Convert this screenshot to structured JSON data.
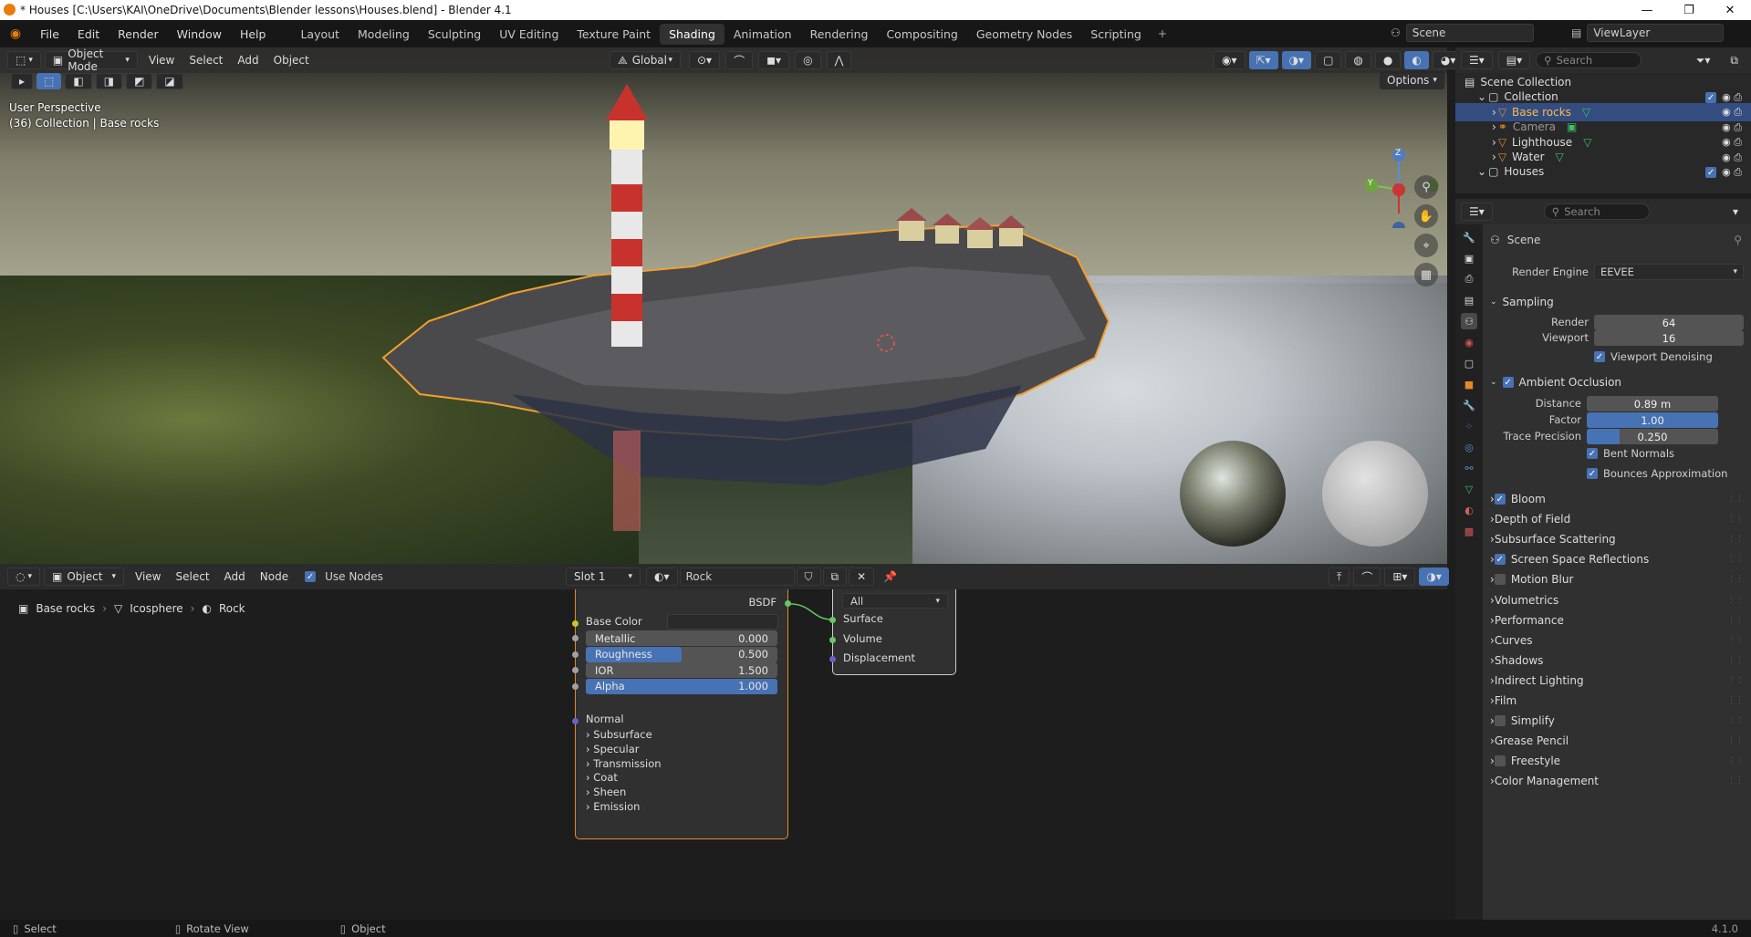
{
  "window": {
    "title": "* Houses [C:\\Users\\KAI\\OneDrive\\Documents\\Blender lessons\\Houses.blend] - Blender 4.1",
    "minimize": "—",
    "maximize": "❐",
    "close": "✕"
  },
  "menu": [
    "File",
    "Edit",
    "Render",
    "Window",
    "Help"
  ],
  "workspaces": [
    "Layout",
    "Modeling",
    "Sculpting",
    "UV Editing",
    "Texture Paint",
    "Shading",
    "Animation",
    "Rendering",
    "Compositing",
    "Geometry Nodes",
    "Scripting"
  ],
  "active_workspace": "Shading",
  "scene_field": "Scene",
  "viewlayer_field": "ViewLayer",
  "viewport": {
    "mode": "Object Mode",
    "menu": [
      "View",
      "Select",
      "Add",
      "Object"
    ],
    "transform_orientation": "Global",
    "options_label": "Options",
    "overlay_line1": "User Perspective",
    "overlay_line2": "(36) Collection | Base rocks",
    "gizmo_axes": {
      "z": "Z",
      "y": "Y"
    }
  },
  "node_editor": {
    "type": "Object",
    "menu": [
      "View",
      "Select",
      "Add",
      "Node"
    ],
    "use_nodes_label": "Use Nodes",
    "slot": "Slot 1",
    "material": "Rock",
    "breadcrumb": [
      "Base rocks",
      "Icosphere",
      "Rock"
    ],
    "bsdf": {
      "header": "BSDF",
      "base_color_label": "Base Color",
      "fields": [
        {
          "label": "Metallic",
          "value": "0.000",
          "fill": 0
        },
        {
          "label": "Roughness",
          "value": "0.500",
          "fill": 0.5
        },
        {
          "label": "IOR",
          "value": "1.500",
          "fill": 0
        },
        {
          "label": "Alpha",
          "value": "1.000",
          "fill": 1
        }
      ],
      "normal_label": "Normal",
      "subpanels": [
        "Subsurface",
        "Specular",
        "Transmission",
        "Coat",
        "Sheen",
        "Emission"
      ]
    },
    "material_output": {
      "target": "All",
      "inputs": [
        "Surface",
        "Volume",
        "Displacement"
      ]
    }
  },
  "outliner": {
    "search_placeholder": "Search",
    "rows": [
      {
        "label": "Scene Collection",
        "indent": 0,
        "kind": "scene"
      },
      {
        "label": "Collection",
        "indent": 1,
        "kind": "collection"
      },
      {
        "label": "Base rocks",
        "indent": 2,
        "kind": "mesh",
        "selected": true
      },
      {
        "label": "Camera",
        "indent": 2,
        "kind": "camera"
      },
      {
        "label": "Lighthouse",
        "indent": 2,
        "kind": "mesh"
      },
      {
        "label": "Water",
        "indent": 2,
        "kind": "mesh"
      },
      {
        "label": "Houses",
        "indent": 1,
        "kind": "collection"
      }
    ]
  },
  "properties": {
    "search_placeholder": "Search",
    "context": "Scene",
    "render_engine_label": "Render Engine",
    "render_engine": "EEVEE",
    "sampling": {
      "title": "Sampling",
      "render_label": "Render",
      "render_value": "64",
      "viewport_label": "Viewport",
      "viewport_value": "16",
      "denoise_label": "Viewport Denoising"
    },
    "ao": {
      "title": "Ambient Occlusion",
      "distance_label": "Distance",
      "distance_value": "0.89 m",
      "factor_label": "Factor",
      "factor_value": "1.00",
      "factor_fill": 1,
      "trace_label": "Trace Precision",
      "trace_value": "0.250",
      "trace_fill": 0.25,
      "bent_label": "Bent Normals",
      "bounces_label": "Bounces Approximation"
    },
    "panels": [
      {
        "label": "Bloom",
        "check": true
      },
      {
        "label": "Depth of Field"
      },
      {
        "label": "Subsurface Scattering"
      },
      {
        "label": "Screen Space Reflections",
        "check": true
      },
      {
        "label": "Motion Blur",
        "check": false
      },
      {
        "label": "Volumetrics"
      },
      {
        "label": "Performance"
      },
      {
        "label": "Curves"
      },
      {
        "label": "Shadows"
      },
      {
        "label": "Indirect Lighting"
      },
      {
        "label": "Film"
      },
      {
        "label": "Simplify",
        "check": false
      },
      {
        "label": "Grease Pencil"
      },
      {
        "label": "Freestyle",
        "check": false
      },
      {
        "label": "Color Management"
      }
    ]
  },
  "statusbar": {
    "select": "Select",
    "rotate": "Rotate View",
    "object": "Object",
    "version": "4.1.0"
  },
  "colors": {
    "accent": "#4772b3",
    "selection": "#e08a2b",
    "active_bg": "#334d80"
  }
}
